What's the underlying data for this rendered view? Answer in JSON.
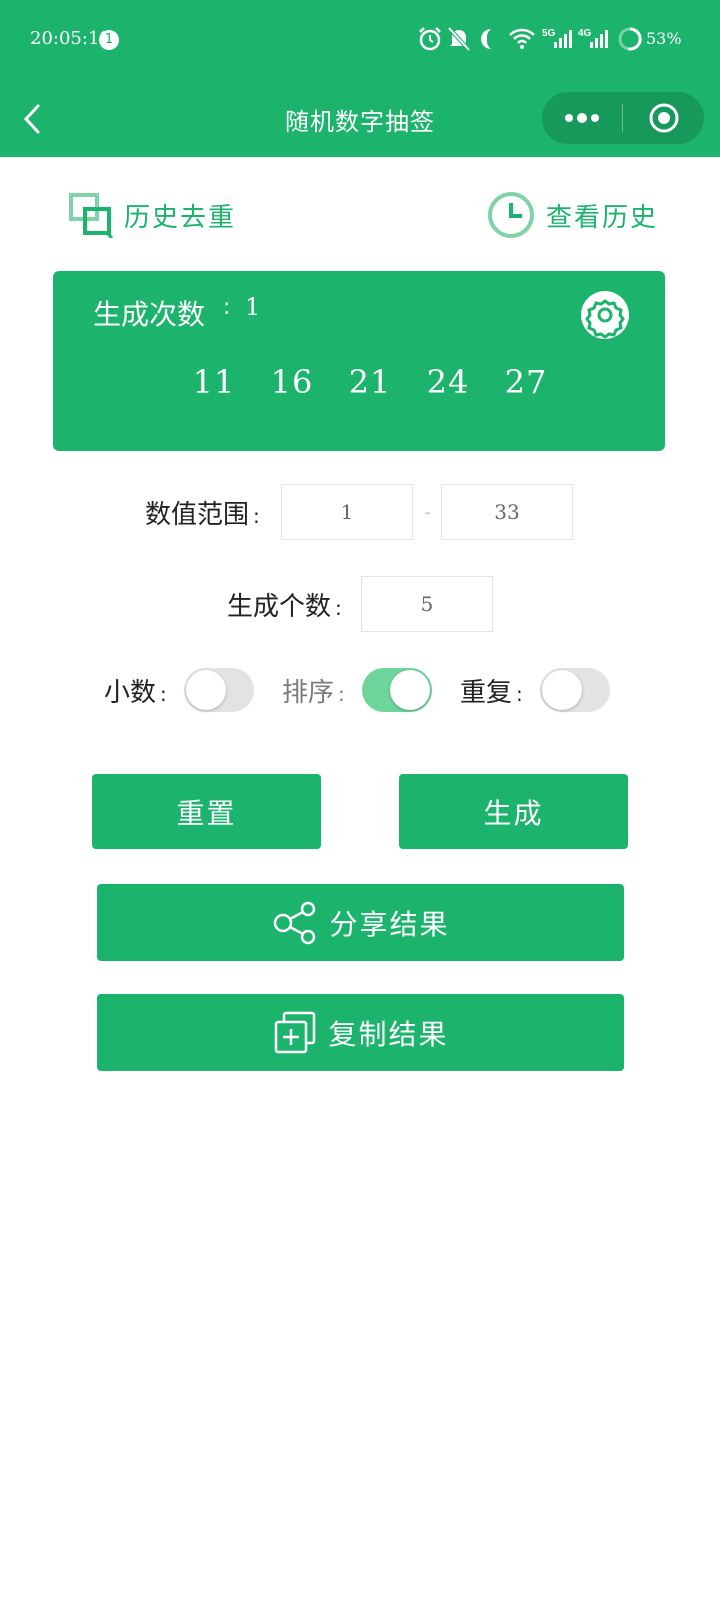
{
  "status_bar": {
    "time": "20:05:19",
    "notification_count": "1",
    "network_5g": "5G",
    "network_4g": "4G",
    "battery": "53%"
  },
  "nav": {
    "title": "随机数字抽签"
  },
  "links": {
    "dedupe_history": "历史去重",
    "view_history": "查看历史"
  },
  "result": {
    "count_label": "生成次数",
    "colon": ":",
    "count": "1",
    "numbers": [
      "11",
      "16",
      "21",
      "24",
      "27"
    ]
  },
  "form": {
    "range_label": "数值范围",
    "range_min": "1",
    "range_separator": "-",
    "range_max": "33",
    "quantity_label": "生成个数",
    "quantity": "5",
    "colon": ":",
    "toggles": [
      {
        "label": "小数",
        "on": false
      },
      {
        "label": "排序",
        "on": true
      },
      {
        "label": "重复",
        "on": false
      }
    ]
  },
  "buttons": {
    "reset": "重置",
    "generate": "生成",
    "share": "分享结果",
    "copy": "复制结果"
  },
  "colors": {
    "primary": "#1cb46d",
    "toggle_on": "#6fd69b",
    "toggle_off": "#e3e3e3"
  }
}
